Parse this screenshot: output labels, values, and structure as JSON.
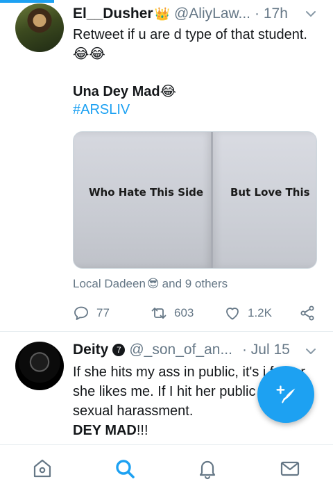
{
  "colors": {
    "accent": "#1da1f2",
    "text": "#14171a",
    "muted": "#657786"
  },
  "tweets": [
    {
      "name": "El__Dusher",
      "name_emoji": "👑",
      "handle": "@AliyLaw...",
      "time": "· 17h",
      "text_line1": "Retweet if u are d type of that student.😂😂",
      "text_bold": "Una Dey Mad😂",
      "hashtag": "#ARSLIV",
      "media": {
        "left_text": "Who Hate This Side",
        "right_text": "But Love This"
      },
      "liked_by": {
        "name": "Local Dadeen",
        "emoji": "😎",
        "rest": "and 9 others"
      },
      "actions": {
        "replies": "77",
        "retweets": "603",
        "likes": "1.2K"
      }
    },
    {
      "name": "Deity",
      "badge": "7",
      "handle": "@_son_of_an...",
      "time": "· Jul 15",
      "text": "If she hits my ass in public, it's i fun or she likes me. If I hit her public it's sexual harassment.",
      "text_bold": "DEY MAD",
      "text_bold_tail": "!!!"
    }
  ],
  "icons": {
    "chevron": "chevron-down-icon",
    "reply": "reply-icon",
    "retweet": "retweet-icon",
    "like": "heart-icon",
    "share": "share-icon",
    "compose": "compose-icon",
    "home": "home-icon",
    "search": "search-icon",
    "notifications": "bell-icon",
    "messages": "mail-icon"
  }
}
